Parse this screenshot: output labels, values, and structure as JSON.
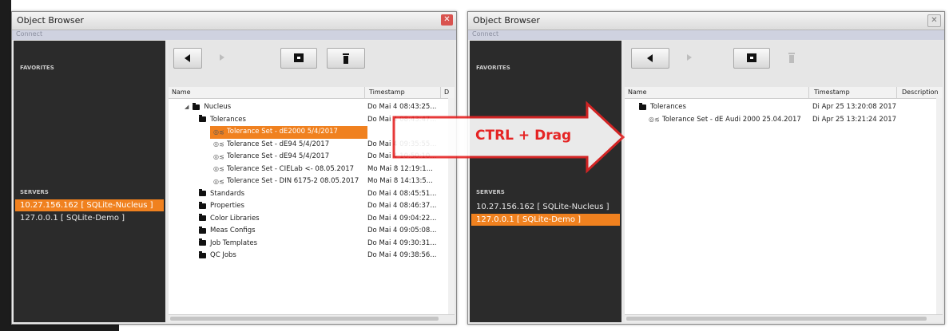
{
  "left_window": {
    "title": "Object Browser",
    "close_glyph": "✕",
    "menu_connect": "Connect",
    "favorites_label": "FAVORITES",
    "servers_label": "SERVERS",
    "servers": [
      "10.27.156.162 [ SQLite-Nucleus ]",
      "127.0.0.1 [ SQLite-Demo ]"
    ],
    "selected_server": 0,
    "columns": {
      "name": "Name",
      "timestamp": "Timestamp",
      "description": "D"
    },
    "rows": [
      {
        "name": "Nucleus",
        "ts": "Do Mai 4 08:43:25...",
        "icon": "folder-icon",
        "level": 0
      },
      {
        "name": "Tolerances",
        "ts": "Do Mai 4 08:43:47...",
        "icon": "folder-icon",
        "level": 1
      },
      {
        "name": "Tolerance Set - dE2000 5/4/2017",
        "ts": "Do Mai 4 08:43:52...",
        "icon": "tolerance-icon",
        "level": 2,
        "selected": true
      },
      {
        "name": "Tolerance Set - dE94 5/4/2017",
        "ts": "Do Mai 4 09:35:55...",
        "icon": "tolerance-icon",
        "level": 2
      },
      {
        "name": "Tolerance Set - dE94 5/4/2017",
        "ts": "Do Mai 4 10:50:10...",
        "icon": "tolerance-icon",
        "level": 2
      },
      {
        "name": "Tolerance Set - CIELab <- 08.05.2017",
        "ts": "Mo Mai 8 12:19:1...",
        "icon": "tolerance-icon",
        "level": 2
      },
      {
        "name": "Tolerance Set - DIN 6175-2 08.05.2017",
        "ts": "Mo Mai 8 14:13:5...",
        "icon": "tolerance-icon",
        "level": 2
      },
      {
        "name": "Standards",
        "ts": "Do Mai 4 08:45:51...",
        "icon": "folder-icon",
        "level": 1
      },
      {
        "name": "Properties",
        "ts": "Do Mai 4 08:46:37...",
        "icon": "folder-icon",
        "level": 1
      },
      {
        "name": "Color Libraries",
        "ts": "Do Mai 4 09:04:22...",
        "icon": "folder-icon",
        "level": 1
      },
      {
        "name": "Meas Configs",
        "ts": "Do Mai 4 09:05:08...",
        "icon": "folder-icon",
        "level": 1
      },
      {
        "name": "Job Templates",
        "ts": "Do Mai 4 09:30:31...",
        "icon": "folder-icon",
        "level": 1
      },
      {
        "name": "QC Jobs",
        "ts": "Do Mai 4 09:38:56...",
        "icon": "folder-icon",
        "level": 1
      }
    ]
  },
  "right_window": {
    "title": "Object Browser",
    "close_glyph": "✕",
    "menu_connect": "Connect",
    "favorites_label": "FAVORITES",
    "servers_label": "SERVERS",
    "servers": [
      "10.27.156.162 [ SQLite-Nucleus ]",
      "127.0.0.1 [ SQLite-Demo ]"
    ],
    "selected_server": 1,
    "columns": {
      "name": "Name",
      "timestamp": "Timestamp",
      "description": "Description"
    },
    "rows": [
      {
        "name": "Tolerances",
        "ts": "Di Apr 25 13:20:08 2017",
        "icon": "folder-icon",
        "level": 1
      },
      {
        "name": "Tolerance Set - dE Audi 2000 25.04.2017",
        "ts": "Di Apr 25 13:21:24 2017",
        "icon": "tolerance-icon",
        "level": 2
      }
    ]
  },
  "annotation": {
    "text": "CTRL + Drag",
    "color": "#e52424"
  },
  "colors": {
    "selection": "#f0811f",
    "sidebar": "#2b2b2b",
    "menubar": "#cfd2e0"
  },
  "toolbar_icons": [
    "back-arrow-icon",
    "forward-arrow-icon",
    "new-folder-icon",
    "delete-trash-icon"
  ]
}
